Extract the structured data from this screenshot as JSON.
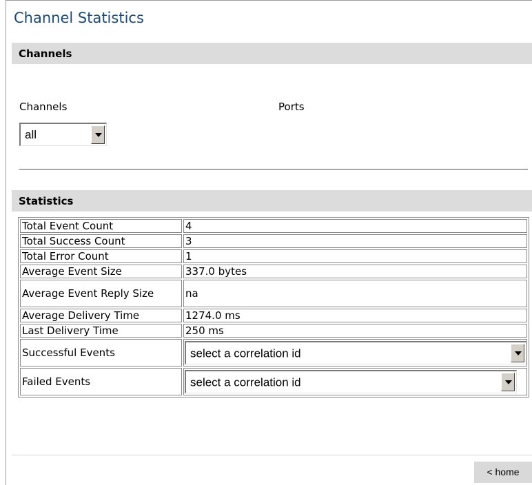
{
  "page": {
    "title": "Channel Statistics"
  },
  "channels_section": {
    "heading": "Channels",
    "channels_label": "Channels",
    "ports_label": "Ports",
    "channel_select_value": "all"
  },
  "statistics_section": {
    "heading": "Statistics",
    "rows": [
      {
        "label": "Total Event Count",
        "value": "4"
      },
      {
        "label": "Total Success Count",
        "value": "3"
      },
      {
        "label": "Total Error Count",
        "value": "1"
      },
      {
        "label": "Average Event Size",
        "value": "337.0 bytes"
      },
      {
        "label": "Average Event Reply Size",
        "value": "na"
      },
      {
        "label": "Average Delivery Time",
        "value": "1274.0 ms"
      },
      {
        "label": "Last Delivery Time",
        "value": "250 ms"
      }
    ],
    "successful_events_label": "Successful Events",
    "successful_events_select": "select a correlation id",
    "failed_events_label": "Failed Events",
    "failed_events_select": "select a correlation id"
  },
  "footer": {
    "home_label": "< home"
  }
}
